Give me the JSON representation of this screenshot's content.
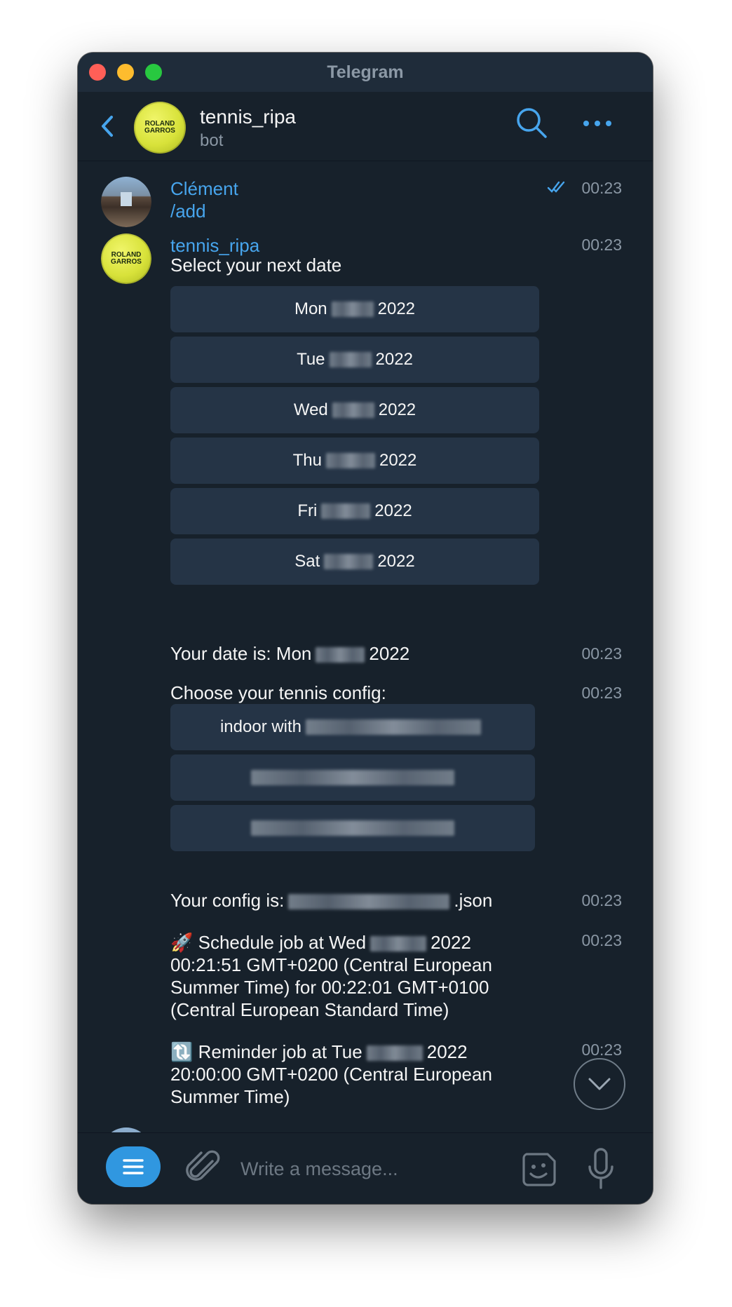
{
  "window": {
    "title": "Telegram"
  },
  "chat": {
    "name": "tennis_ripa",
    "status": "bot",
    "avatar_text": [
      "ROLAND",
      "GARROS"
    ]
  },
  "messages": {
    "user_sender": "Clément",
    "user_command": "/add",
    "user_time": "00:23",
    "bot_sender": "tennis_ripa",
    "bot_time": "00:23",
    "select_date": "Select your next date",
    "date_buttons": [
      {
        "day": "Mon",
        "year": "2022"
      },
      {
        "day": "Tue",
        "year": "2022"
      },
      {
        "day": "Wed",
        "year": "2022"
      },
      {
        "day": "Thu",
        "year": "2022"
      },
      {
        "day": "Fri",
        "year": "2022"
      },
      {
        "day": "Sat",
        "year": "2022"
      }
    ],
    "date_is_prefix": "Your date is: Mon",
    "date_is_year": "2022",
    "date_is_time": "00:23",
    "choose_config": "Choose your tennis config:",
    "choose_config_time": "00:23",
    "config_buttons": [
      {
        "label": "indoor with"
      },
      {
        "label": ""
      },
      {
        "label": ""
      }
    ],
    "config_is_prefix": "Your config is:",
    "config_is_suffix": ".json",
    "config_is_time": "00:23",
    "schedule_line1_prefix": "🚀 Schedule job at Wed",
    "schedule_line1_year": "2022",
    "schedule_line2": "00:21:51 GMT+0200 (Central European",
    "schedule_line3": "Summer Time) for 00:22:01 GMT+0100",
    "schedule_line4": "(Central European Standard Time)",
    "schedule_time": "00:23",
    "reminder_line1_prefix": "🔃 Reminder job at Tue",
    "reminder_line1_year": "2022",
    "reminder_line2": "20:00:00 GMT+0200 (Central European",
    "reminder_line3": "Summer Time)",
    "reminder_time": "00:23"
  },
  "composer": {
    "placeholder": "Write a message..."
  },
  "colors": {
    "background": "#17212b",
    "titlebar": "#1f2c3a",
    "accent": "#47a5ed",
    "button": "#253446",
    "menu_button": "#3097e0"
  },
  "icons": [
    "back-arrow-icon",
    "search-icon",
    "more-icon",
    "read-ticks-icon",
    "menu-icon",
    "paperclip-icon",
    "sticker-icon",
    "microphone-icon",
    "chevron-down-icon"
  ]
}
